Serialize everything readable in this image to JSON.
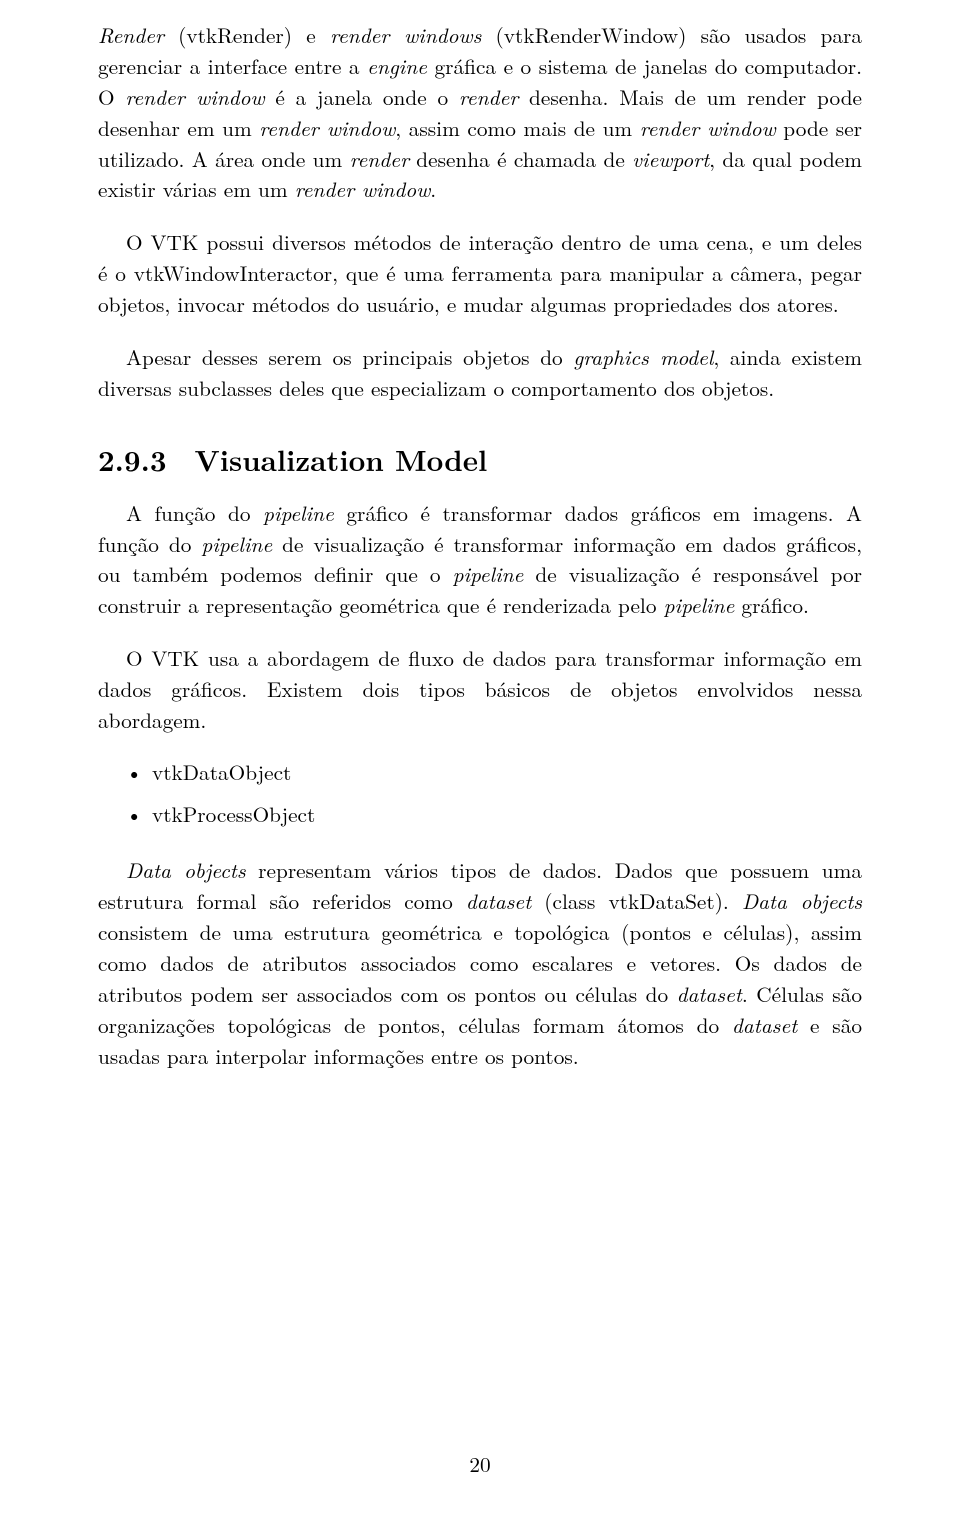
{
  "p1_a": "Render",
  "p1_b": " (vtkRender) e ",
  "p1_c": "render windows",
  "p1_d": " (vtkRenderWindow) são usados para gerenciar a interface entre a ",
  "p1_e": "engine",
  "p1_f": " gráfica e o sistema de janelas do computador. O ",
  "p1_g": "render window",
  "p1_h": " é a janela onde o ",
  "p1_i": "render",
  "p1_j": " desenha. Mais de um render pode desenhar em um ",
  "p1_k": "render window",
  "p1_l": ", assim como mais de um ",
  "p1_m": "render window",
  "p1_n": " pode ser utilizado. A área onde um ",
  "p1_o": "render",
  "p1_p": " desenha é chamada de ",
  "p1_q": "viewport",
  "p1_r": ", da qual podem existir várias em um ",
  "p1_s": "render window",
  "p1_t": ".",
  "p2": "O VTK possui diversos métodos de interação dentro de uma cena, e um deles é o vtkWindowInteractor, que é uma ferramenta para manipular a câmera, pegar objetos, invocar métodos do usuário, e mudar algumas propriedades dos atores.",
  "p3_a": "Apesar desses serem os principais objetos do ",
  "p3_b": "graphics model",
  "p3_c": ", ainda existem diversas subclasses deles que especializam o comportamento dos objetos.",
  "heading_num": "2.9.3",
  "heading_text": "Visualization Model",
  "p4_a": "A função do ",
  "p4_b": "pipeline",
  "p4_c": " gráfico é transformar dados gráficos em imagens. A função do ",
  "p4_d": "pipeline",
  "p4_e": " de visualização é transformar informação em dados gráficos, ou também podemos definir que o ",
  "p4_f": "pipeline",
  "p4_g": " de visualização é responsável por construir a representação geométrica que é renderizada pelo ",
  "p4_h": "pipeline",
  "p4_i": " gráfico.",
  "p5": "O VTK usa a abordagem de fluxo de dados para transformar informação em dados gráficos. Existem dois tipos básicos de objetos envolvidos nessa abordagem.",
  "bullets": {
    "b1": "vtkDataObject",
    "b2": "vtkProcessObject"
  },
  "p6_a": "Data objects",
  "p6_b": " representam vários tipos de dados. Dados que possuem uma estrutura formal são referidos como ",
  "p6_c": "dataset",
  "p6_d": " (class vtkDataSet). ",
  "p6_e": "Data objects",
  "p6_f": " consistem de uma estrutura geométrica e topológica (pontos e células), assim como dados de atributos associados como escalares e vetores. Os dados de atributos podem ser associados com os pontos ou células do ",
  "p6_g": "dataset",
  "p6_h": ". Células são organizações topológicas de pontos, células formam átomos do ",
  "p6_i": "dataset",
  "p6_j": " e são usadas para interpolar informações entre os pontos.",
  "page_number": "20"
}
